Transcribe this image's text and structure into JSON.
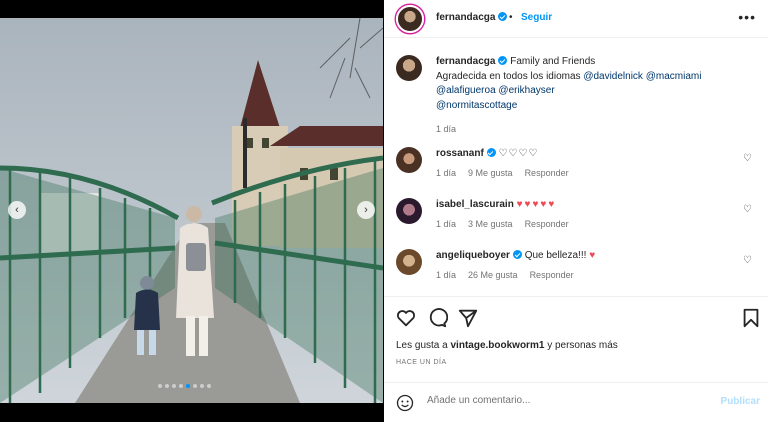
{
  "header": {
    "username": "fernandacga",
    "separator": "•",
    "follow_label": "Seguir",
    "more_label": "•••"
  },
  "caption": {
    "username": "fernandacga",
    "title": "Family and Friends",
    "text": "Agradecida en todos los idiomas",
    "mentions": [
      "@davidelnick",
      "@macmiami",
      "@alafigueroa",
      "@erikhayser",
      "@normitascottage"
    ],
    "time": "1 día"
  },
  "comments": [
    {
      "username": "rossananf",
      "text": "♡♡♡♡",
      "time": "1 día",
      "likes": "9 Me gusta",
      "reply": "Responder"
    },
    {
      "username": "isabel_lascurain",
      "text": "♥♥♥♥♥",
      "time": "1 día",
      "likes": "3 Me gusta",
      "reply": "Responder"
    },
    {
      "username": "angeliqueboyer",
      "text": "Que belleza!!!",
      "emoji": "♥",
      "time": "1 día",
      "likes": "26 Me gusta",
      "reply": "Responder"
    }
  ],
  "likes": {
    "prefix": "Les gusta a",
    "user": "vintage.bookworm1",
    "suffix": "y personas más"
  },
  "date_label": "HACE UN DÍA",
  "comment_box": {
    "placeholder": "Añade un comentario...",
    "post_label": "Publicar"
  },
  "media": {
    "prev": "‹",
    "next": "›",
    "slide_count": 8,
    "active_slide": 4
  },
  "colors": {
    "accent": "#0095f6",
    "heart": "#ed4956",
    "bridge": "#2f6b4f"
  }
}
